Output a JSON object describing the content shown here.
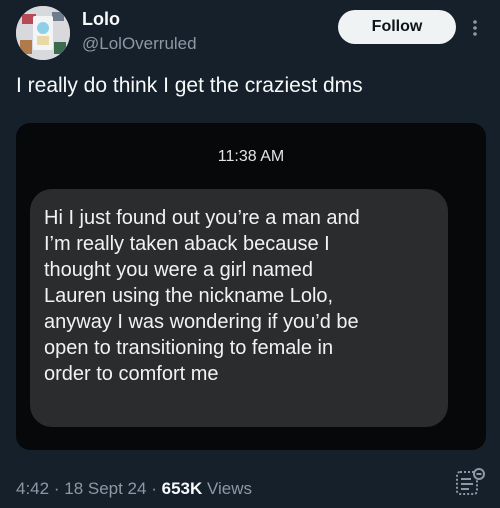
{
  "user": {
    "display_name": "Lolo",
    "handle": "@LolOverruled"
  },
  "header": {
    "follow_label": "Follow",
    "more_icon": "more-vertical-icon"
  },
  "tweet": {
    "text": "I really do think I get the craziest dms"
  },
  "screenshot": {
    "timestamp": "11:38 AM",
    "message_lines": [
      "Hi I just found out you’re a man and",
      "I’m really taken aback because I",
      "thought you were a girl named",
      "Lauren using the nickname Lolo,",
      "anyway I was wondering if you’d be",
      "open to transitioning to female in",
      "order to comfort me"
    ]
  },
  "meta": {
    "time": "4:42",
    "separator": "·",
    "date": "18 Sept 24",
    "views_count": "653K",
    "views_label": "Views",
    "analytics_icon": "analytics-icon"
  },
  "colors": {
    "background": "#15202b",
    "follow_bg": "#eff3f4",
    "bubble": "#2b2c2e",
    "muted_text": "#8b98a5"
  }
}
